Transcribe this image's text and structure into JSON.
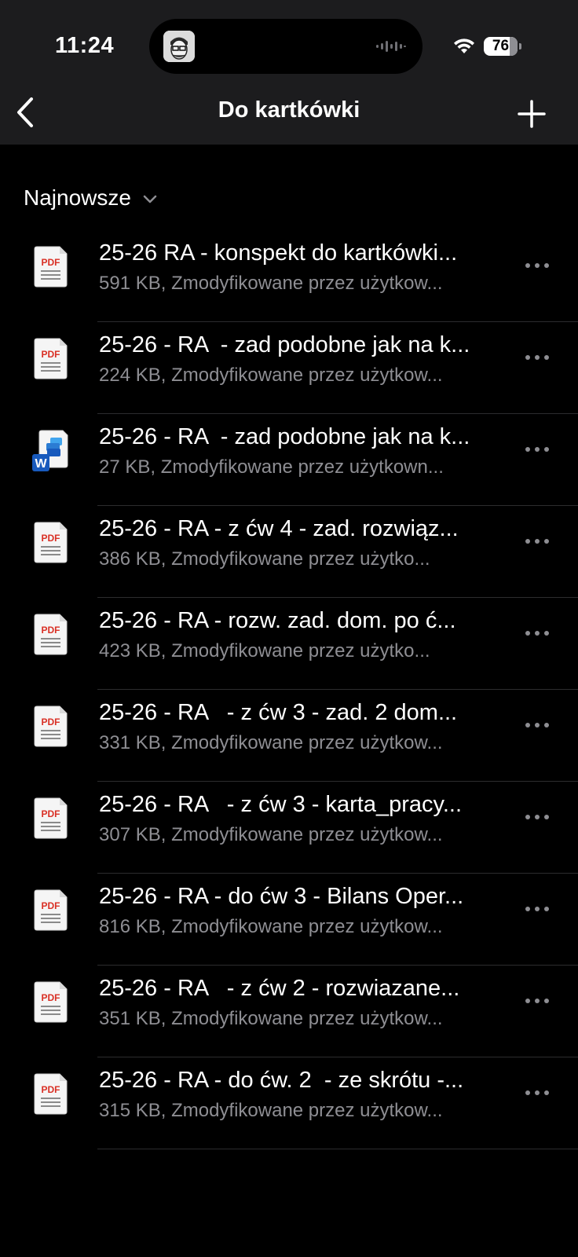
{
  "status_bar": {
    "time": "11:24",
    "battery": "76",
    "battery_level": 0.76
  },
  "nav": {
    "title": "Do kartkówki",
    "back_icon": "chevron-left-icon",
    "add_icon": "plus-icon"
  },
  "sort": {
    "label": "Najnowsze",
    "icon": "chevron-down-icon"
  },
  "colors": {
    "background": "#000000",
    "header": "#1c1c1e",
    "secondary_text": "#8e8e93",
    "pdf_red": "#d93025",
    "word_blue": "#185abd"
  },
  "files": [
    {
      "type": "pdf",
      "name": "25-26 RA - konspekt do kartkówki...",
      "meta": "591 KB, Zmodyfikowane przez użytkow..."
    },
    {
      "type": "pdf",
      "name": "25-26 - RA  - zad podobne jak na k...",
      "meta": "224 KB, Zmodyfikowane przez użytkow..."
    },
    {
      "type": "word",
      "name": "25-26 - RA  - zad podobne jak na k...",
      "meta": "27 KB, Zmodyfikowane przez użytkown..."
    },
    {
      "type": "pdf",
      "name": "25-26 - RA - z ćw 4 - zad. rozwiąz...",
      "meta": "386 KB, Zmodyfikowane przez użytko..."
    },
    {
      "type": "pdf",
      "name": "25-26 - RA - rozw. zad. dom. po ć...",
      "meta": "423 KB, Zmodyfikowane przez użytko..."
    },
    {
      "type": "pdf",
      "name": "25-26 - RA   - z ćw 3 - zad. 2 dom...",
      "meta": "331 KB, Zmodyfikowane przez użytkow..."
    },
    {
      "type": "pdf",
      "name": "25-26 - RA   - z ćw 3 - karta_pracy...",
      "meta": "307 KB, Zmodyfikowane przez użytkow..."
    },
    {
      "type": "pdf",
      "name": "25-26 - RA - do ćw 3 - Bilans Oper...",
      "meta": "816 KB, Zmodyfikowane przez użytkow..."
    },
    {
      "type": "pdf",
      "name": "25-26 - RA   - z ćw 2 - rozwiazane...",
      "meta": "351 KB, Zmodyfikowane przez użytkow..."
    },
    {
      "type": "pdf",
      "name": "25-26 - RA - do ćw. 2  - ze skrótu -...",
      "meta": "315 KB, Zmodyfikowane przez użytkow..."
    }
  ]
}
